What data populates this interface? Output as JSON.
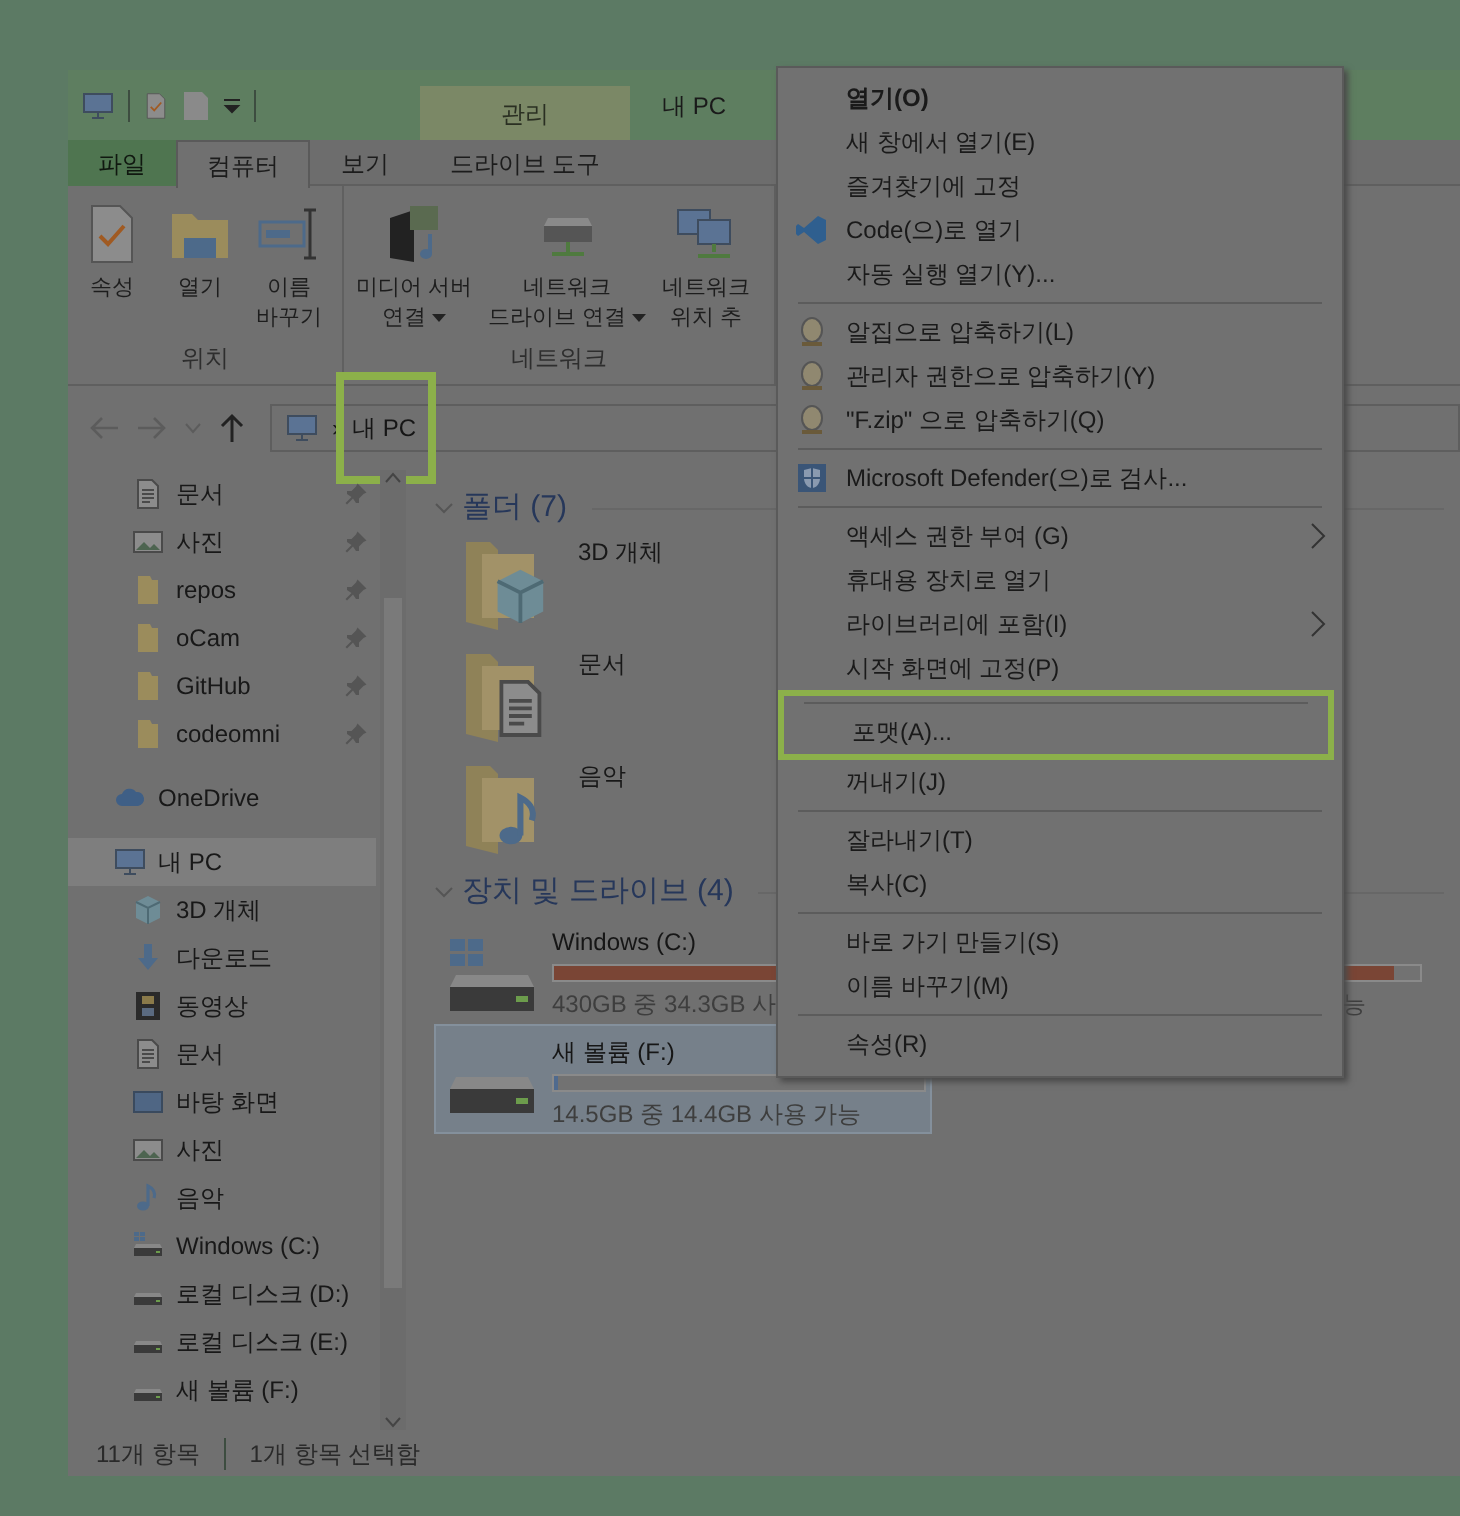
{
  "window": {
    "title": "내 PC",
    "context_tab": "관리"
  },
  "ribbon": {
    "tabs": [
      {
        "label": "파일",
        "kind": "file",
        "selected": false
      },
      {
        "label": "컴퓨터",
        "kind": "tab",
        "selected": true
      },
      {
        "label": "보기",
        "kind": "tab",
        "selected": false
      },
      {
        "label": "드라이브 도구",
        "kind": "tab",
        "selected": false
      }
    ],
    "groups": [
      {
        "label": "위치",
        "buttons": [
          {
            "kind": "properties",
            "lines": [
              "속성"
            ],
            "dropdown": false
          },
          {
            "kind": "open",
            "lines": [
              "열기"
            ],
            "dropdown": false
          },
          {
            "kind": "rename",
            "lines": [
              "이름",
              "바꾸기"
            ],
            "dropdown": false
          }
        ]
      },
      {
        "label": "네트워크",
        "buttons": [
          {
            "kind": "media",
            "lines": [
              "미디어 서버",
              "연결"
            ],
            "dropdown": true
          },
          {
            "kind": "netdrive",
            "lines": [
              "네트워크",
              "드라이브 연결"
            ],
            "dropdown": true
          },
          {
            "kind": "netplace",
            "lines": [
              "네트워크",
              "위치 추"
            ],
            "dropdown": false
          }
        ]
      }
    ]
  },
  "address": {
    "separator": "›",
    "path": "내 PC",
    "highlighted": true
  },
  "nav": {
    "quick_access": [
      {
        "label": "문서",
        "kind": "doc",
        "pinned": true,
        "selected": false
      },
      {
        "label": "사진",
        "kind": "image",
        "pinned": true,
        "selected": false
      },
      {
        "label": "repos",
        "kind": "folder",
        "pinned": true,
        "selected": false
      },
      {
        "label": "oCam",
        "kind": "folder",
        "pinned": true,
        "selected": false
      },
      {
        "label": "GitHub",
        "kind": "folder",
        "pinned": true,
        "selected": false
      },
      {
        "label": "codeomni",
        "kind": "folder",
        "pinned": true,
        "selected": false
      }
    ],
    "items": [
      {
        "label": "OneDrive",
        "kind": "cloud",
        "selected": false
      },
      {
        "label": "내 PC",
        "kind": "computer",
        "selected": true,
        "children": [
          {
            "label": "3D 개체",
            "kind": "cube",
            "selected": false
          },
          {
            "label": "다운로드",
            "kind": "download",
            "selected": false
          },
          {
            "label": "동영상",
            "kind": "film",
            "selected": false
          },
          {
            "label": "문서",
            "kind": "doc",
            "selected": false
          },
          {
            "label": "바탕 화면",
            "kind": "desktop",
            "selected": false
          },
          {
            "label": "사진",
            "kind": "image",
            "selected": false
          },
          {
            "label": "음악",
            "kind": "music",
            "selected": false
          },
          {
            "label": "Windows (C:)",
            "kind": "system-drive",
            "selected": false
          },
          {
            "label": "로컬 디스크 (D:)",
            "kind": "drive",
            "selected": false
          },
          {
            "label": "로컬 디스크 (E:)",
            "kind": "drive",
            "selected": false
          },
          {
            "label": "새 볼륨 (F:)",
            "kind": "drive",
            "selected": false
          }
        ]
      }
    ]
  },
  "content": {
    "folders": {
      "title": "폴더 (7)",
      "expanded": true,
      "items": [
        {
          "label": "3D 개체",
          "kind": "cube"
        },
        {
          "label": "문서",
          "kind": "doc"
        },
        {
          "label": "음악",
          "kind": "music"
        }
      ]
    },
    "drives": {
      "title": "장치 및 드라이브 (4)",
      "expanded": true,
      "items": [
        {
          "label": "Windows (C:)",
          "kind": "system-drive",
          "level": 0.97,
          "usage": "430GB 중 34.3GB 사",
          "usage_tail": "능",
          "selected": false
        },
        {
          "label": "새 볼륨 (F:)",
          "kind": "drive",
          "level": 0.01,
          "usage": "14.5GB 중 14.4GB 사용 가능",
          "selected": true
        }
      ]
    }
  },
  "status_bar": [
    "11개 항목",
    "1개 항목 선택함"
  ],
  "context_menu": [
    {
      "kind": "plain",
      "label": "열기(O)",
      "bold": true
    },
    {
      "kind": "plain",
      "label": "새 창에서 열기(E)"
    },
    {
      "kind": "plain",
      "label": "즐겨찾기에 고정"
    },
    {
      "kind": "app",
      "label": "Code(으)로 열기"
    },
    {
      "kind": "plain",
      "label": "자동 실행 열기(Y)..."
    },
    {
      "kind": "separator"
    },
    {
      "kind": "archive",
      "label": "알집으로 압축하기(L)"
    },
    {
      "kind": "archive",
      "label": "관리자 권한으로 압축하기(Y)"
    },
    {
      "kind": "archive",
      "label": "\"F.zip\" 으로 압축하기(Q)"
    },
    {
      "kind": "separator"
    },
    {
      "kind": "shield",
      "label": "Microsoft Defender(으)로 검사..."
    },
    {
      "kind": "separator"
    },
    {
      "kind": "plain",
      "label": "액세스 권한 부여 (G)",
      "submenu": true
    },
    {
      "kind": "plain",
      "label": "휴대용 장치로 열기"
    },
    {
      "kind": "plain",
      "label": "라이브러리에 포함(I)",
      "submenu": true
    },
    {
      "kind": "plain",
      "label": "시작 화면에 고정(P)"
    },
    {
      "kind": "separator"
    },
    {
      "kind": "plain",
      "label": "포맷(A)...",
      "highlighted": true
    },
    {
      "kind": "plain",
      "label": "꺼내기(J)"
    },
    {
      "kind": "separator"
    },
    {
      "kind": "plain",
      "label": "잘라내기(T)"
    },
    {
      "kind": "plain",
      "label": "복사(C)"
    },
    {
      "kind": "separator"
    },
    {
      "kind": "plain",
      "label": "바로 가기 만들기(S)"
    },
    {
      "kind": "plain",
      "label": "이름 바꾸기(M)"
    },
    {
      "kind": "separator"
    },
    {
      "kind": "plain",
      "label": "속성(R)"
    }
  ]
}
